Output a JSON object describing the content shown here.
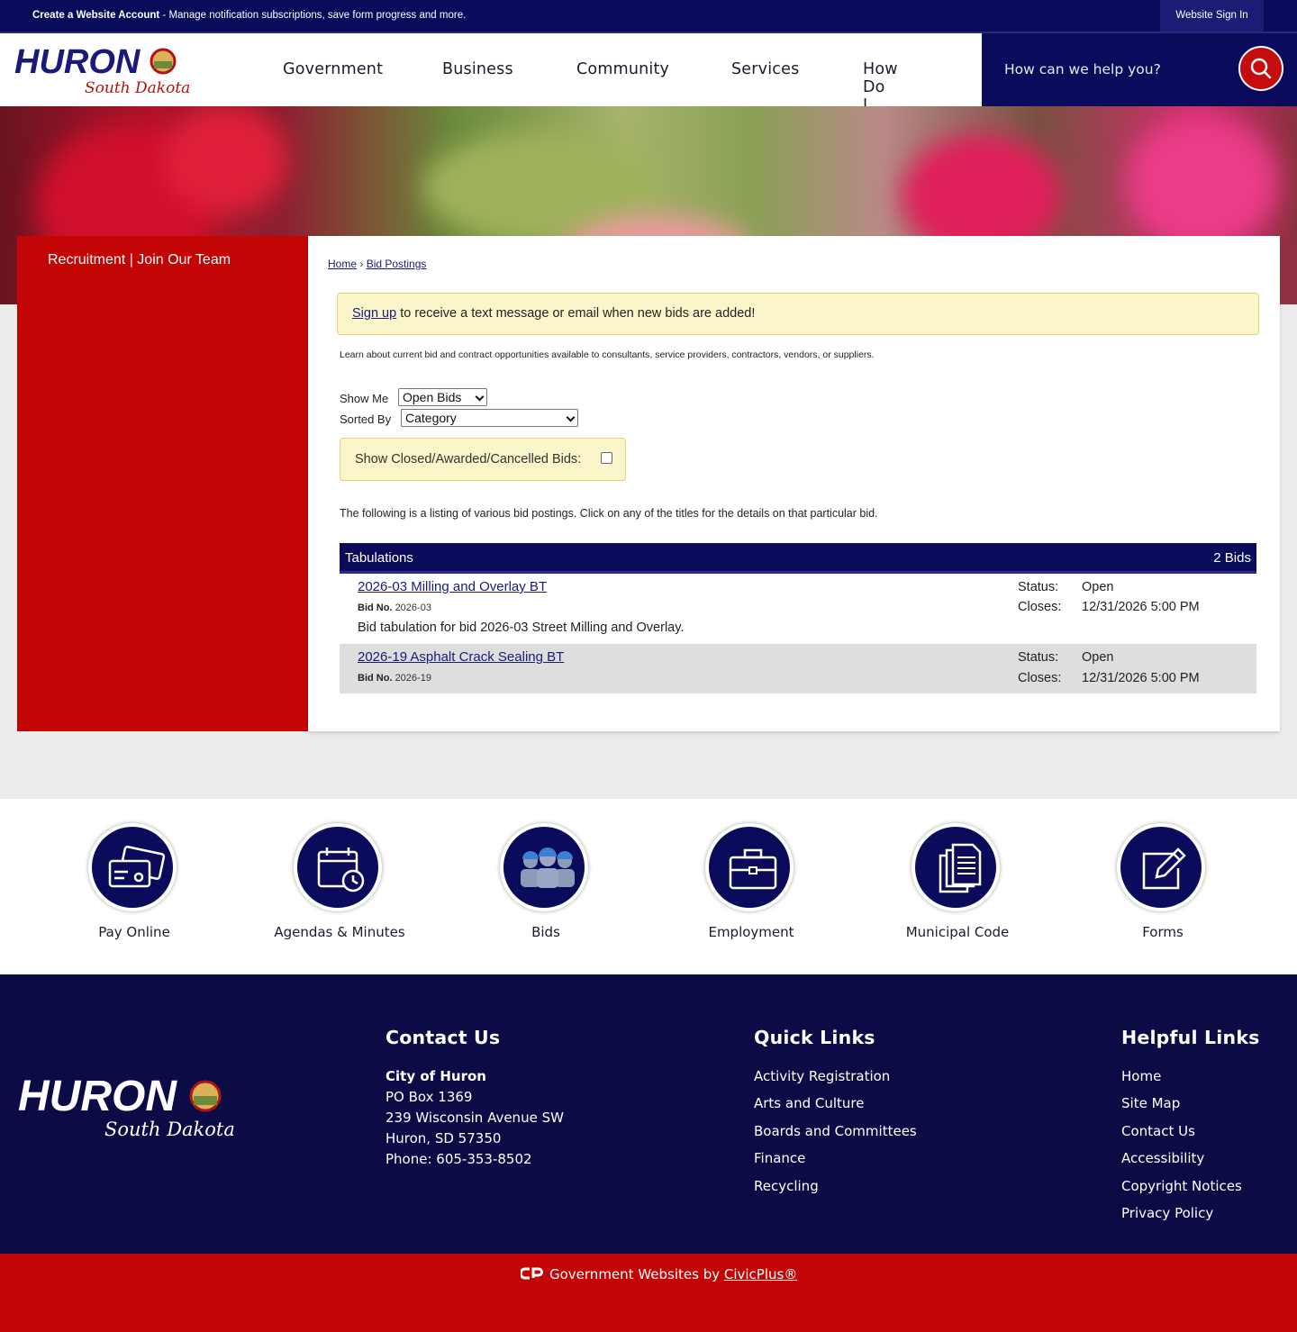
{
  "topbar": {
    "account_strong": "Create a Website Account",
    "account_text": " - Manage notification subscriptions, save form progress and more.",
    "signin": "Website Sign In"
  },
  "logo": {
    "main": "HURON",
    "sub": "South Dakota"
  },
  "nav": [
    "Government",
    "Business",
    "Community",
    "Services",
    "How Do I..."
  ],
  "search": {
    "placeholder": "How can we help you?"
  },
  "sidebar": {
    "link": "Recruitment | Join Our Team"
  },
  "breadcrumb": {
    "home": "Home",
    "sep": "›",
    "current": "Bid Postings"
  },
  "alert": {
    "link": "Sign up",
    "text": " to receive a text message or email when new bids are added!"
  },
  "intro": "Learn about current bid and contract opportunities available to consultants, service providers, contractors, vendors, or suppliers.",
  "filters": {
    "show_me_label": "Show Me",
    "show_me_value": "Open Bids",
    "sorted_by_label": "Sorted By",
    "sorted_by_value": "Category",
    "closed_label": "Show Closed/Awarded/Cancelled Bids:"
  },
  "listing_text": "The following is a listing of various bid postings. Click on any of the titles for the details on that particular bid.",
  "category": {
    "name": "Tabulations",
    "count": "2 Bids"
  },
  "bids": [
    {
      "title": "2026-03 Milling and Overlay BT",
      "no_label": "Bid No.",
      "no": "2026-03",
      "desc": "Bid tabulation for bid 2026-03 Street Milling and Overlay.",
      "status_label": "Status:",
      "status": "Open",
      "closes_label": "Closes:",
      "closes": "12/31/2026 5:00 PM"
    },
    {
      "title": "2026-19 Asphalt Crack Sealing BT",
      "no_label": "Bid No.",
      "no": "2026-19",
      "desc": "",
      "status_label": "Status:",
      "status": "Open",
      "closes_label": "Closes:",
      "closes": "12/31/2026 5:00 PM"
    }
  ],
  "quick_icons": [
    {
      "label": "Pay Online",
      "icon": "credit-card-icon"
    },
    {
      "label": "Agendas & Minutes",
      "icon": "calendar-clock-icon"
    },
    {
      "label": "Bids",
      "icon": "workers-icon"
    },
    {
      "label": "Employment",
      "icon": "briefcase-icon"
    },
    {
      "label": "Municipal Code",
      "icon": "documents-icon"
    },
    {
      "label": "Forms",
      "icon": "edit-form-icon"
    }
  ],
  "footer": {
    "contact": {
      "heading": "Contact Us",
      "name": "City of Huron",
      "lines": [
        "PO Box 1369",
        "239 Wisconsin Avenue SW",
        "Huron, SD 57350",
        "Phone: 605-353-8502"
      ]
    },
    "quick": {
      "heading": "Quick Links",
      "links": [
        "Activity Registration",
        "Arts and Culture",
        "Boards and Committees",
        "Finance",
        "Recycling"
      ]
    },
    "helpful": {
      "heading": "Helpful Links",
      "links": [
        "Home",
        "Site Map",
        "Contact Us",
        "Accessibility",
        "Copyright Notices",
        "Privacy Policy"
      ]
    }
  },
  "credit": {
    "text": "Government Websites by ",
    "link": "CivicPlus®"
  },
  "colors": {
    "navy": "#0b0b5c",
    "red": "#c30505",
    "alert_bg": "#fbf6c9"
  }
}
